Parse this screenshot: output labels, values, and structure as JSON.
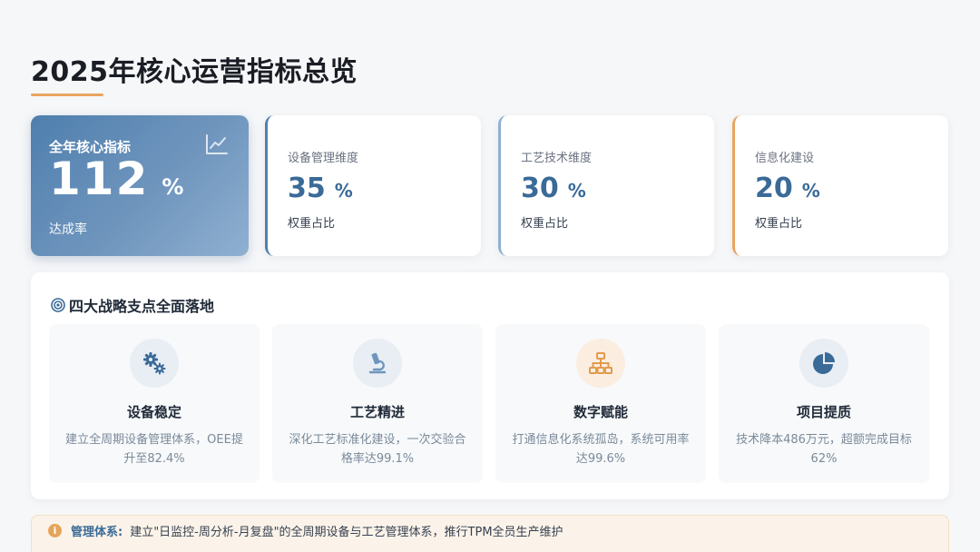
{
  "page": {
    "title": "2025年核心运营指标总览"
  },
  "kpi_main": {
    "label": "全年核心指标",
    "value": "112",
    "unit": "%",
    "sub": "达成率",
    "icon": "trend-chart-icon"
  },
  "kpi_cards": [
    {
      "label": "设备管理维度",
      "value": "35",
      "unit": "%",
      "sub": "权重占比",
      "accent": "#4f7fae"
    },
    {
      "label": "工艺技术维度",
      "value": "30",
      "unit": "%",
      "sub": "权重占比",
      "accent": "#8fb0d1"
    },
    {
      "label": "信息化建设",
      "value": "20",
      "unit": "%",
      "sub": "权重占比",
      "accent": "#e7a55f"
    }
  ],
  "strategy": {
    "title": "四大战略支点全面落地",
    "icon": "target-icon",
    "pillars": [
      {
        "name": "设备稳定",
        "desc": "建立全周期设备管理体系，OEE提升至82.4%",
        "icon": "gears-icon"
      },
      {
        "name": "工艺精进",
        "desc": "深化工艺标准化建设，一次交验合格率达99.1%",
        "icon": "microscope-icon"
      },
      {
        "name": "数字赋能",
        "desc": "打通信息化系统孤岛，系统可用率达99.6%",
        "icon": "network-icon"
      },
      {
        "name": "项目提质",
        "desc": "技术降本486万元，超额完成目标62%",
        "icon": "pie-chart-icon"
      }
    ]
  },
  "bottom_bar": {
    "label": "管理体系:",
    "text": "建立\"日监控-周分析-月复盘\"的全周期设备与工艺管理体系，推行TPM全员生产维护",
    "icon": "info-icon"
  },
  "colors": {
    "primary": "#3a6a98",
    "accent_orange": "#e7a55f",
    "background": "#f6f7f9"
  }
}
